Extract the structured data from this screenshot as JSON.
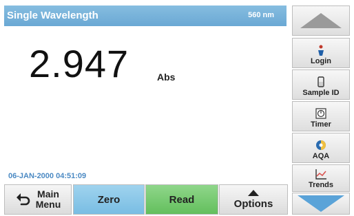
{
  "header": {
    "title": "Single Wavelength",
    "wavelength": "560 nm"
  },
  "reading": {
    "value": "2.947",
    "unit": "Abs"
  },
  "status": {
    "date": "06-JAN-2000",
    "time": "04:51:09"
  },
  "bottom_bar": {
    "main_menu_line1": "Main",
    "main_menu_line2": "Menu",
    "zero_label": "Zero",
    "read_label": "Read",
    "options_label": "Options"
  },
  "sidebar": {
    "items": [
      {
        "label": "Login",
        "icon": "login-icon"
      },
      {
        "label": "Sample ID",
        "icon": "sample-id-icon"
      },
      {
        "label": "Timer",
        "icon": "timer-icon"
      },
      {
        "label": "AQA",
        "icon": "aqa-icon"
      },
      {
        "label": "Trends",
        "icon": "trends-icon"
      }
    ]
  },
  "colors": {
    "title_bar": "#7ab4dc",
    "zero": "#8ccbea",
    "read": "#78c973",
    "date_text": "#4a89c3",
    "scroll_down": "#5aa3d8"
  }
}
